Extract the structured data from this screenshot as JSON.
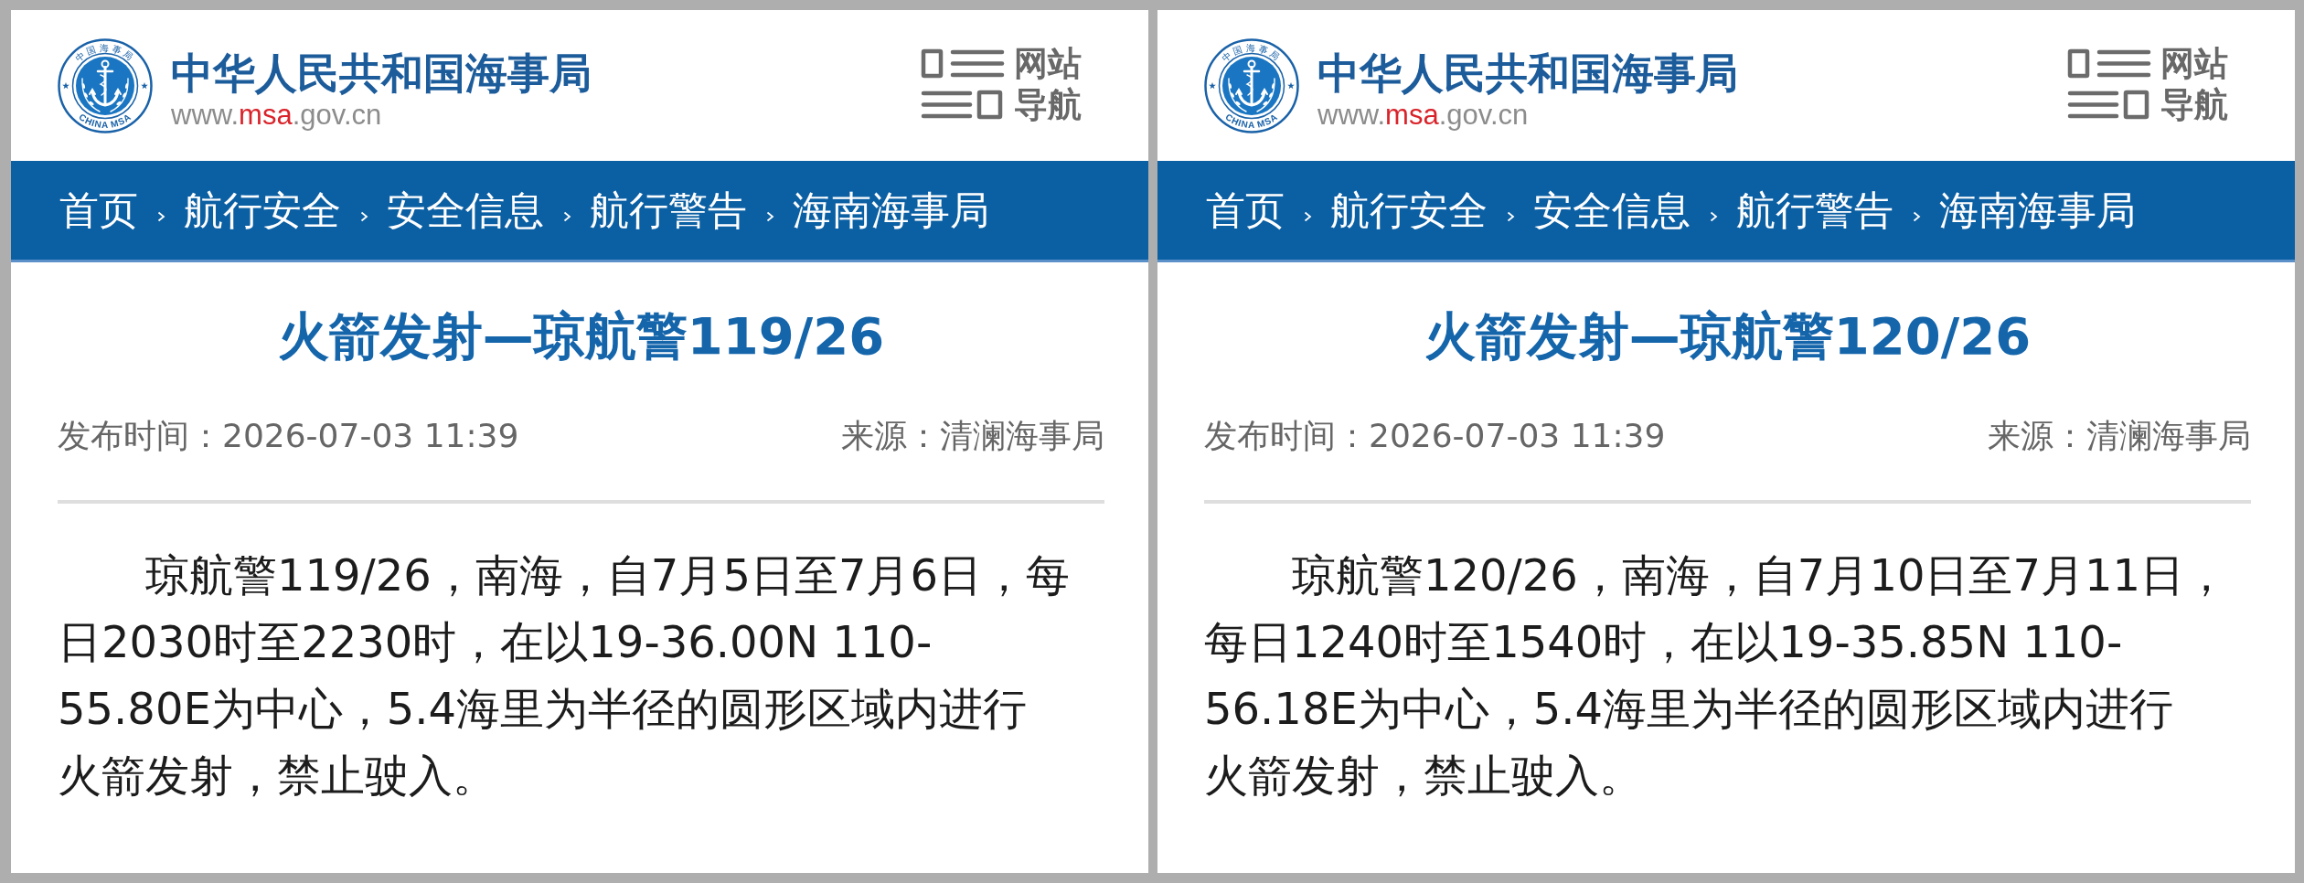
{
  "panels": [
    {
      "header": {
        "emblem": {
          "ring_top": "中国海事局",
          "ring_bottom": "CHINA MSA"
        },
        "site_name": "中华人民共和国海事局",
        "url": {
          "prefix": "www.",
          "highlight": "msa",
          "suffix": ".gov.cn"
        },
        "site_nav": "网站导航"
      },
      "breadcrumb": [
        "首页",
        "航行安全",
        "安全信息",
        "航行警告",
        "海南海事局"
      ],
      "article": {
        "title": "火箭发射—琼航警119/26",
        "published": "发布时间：2026-07-03 11:39",
        "source": "来源：清澜海事局",
        "body_lines": [
          "琼航警119/26，南海，自7月5日至7月6日，每",
          "日2030时至2230时，在以19-36.00N 110-",
          "55.80E为中心，5.4海里为半径的圆形区域内进行",
          "火箭发射，禁止驶入。"
        ]
      }
    },
    {
      "header": {
        "emblem": {
          "ring_top": "中国海事局",
          "ring_bottom": "CHINA MSA"
        },
        "site_name": "中华人民共和国海事局",
        "url": {
          "prefix": "www.",
          "highlight": "msa",
          "suffix": ".gov.cn"
        },
        "site_nav": "网站导航"
      },
      "breadcrumb": [
        "首页",
        "航行安全",
        "安全信息",
        "航行警告",
        "海南海事局"
      ],
      "article": {
        "title": "火箭发射—琼航警120/26",
        "published": "发布时间：2026-07-03 11:39",
        "source": "来源：清澜海事局",
        "body_lines": [
          "琼航警120/26，南海，自7月10日至7月11日，",
          "每日1240时至1540时，在以19-35.85N 110-",
          "56.18E为中心，5.4海里为半径的圆形区域内进行",
          "火箭发射，禁止驶入。"
        ]
      }
    }
  ]
}
